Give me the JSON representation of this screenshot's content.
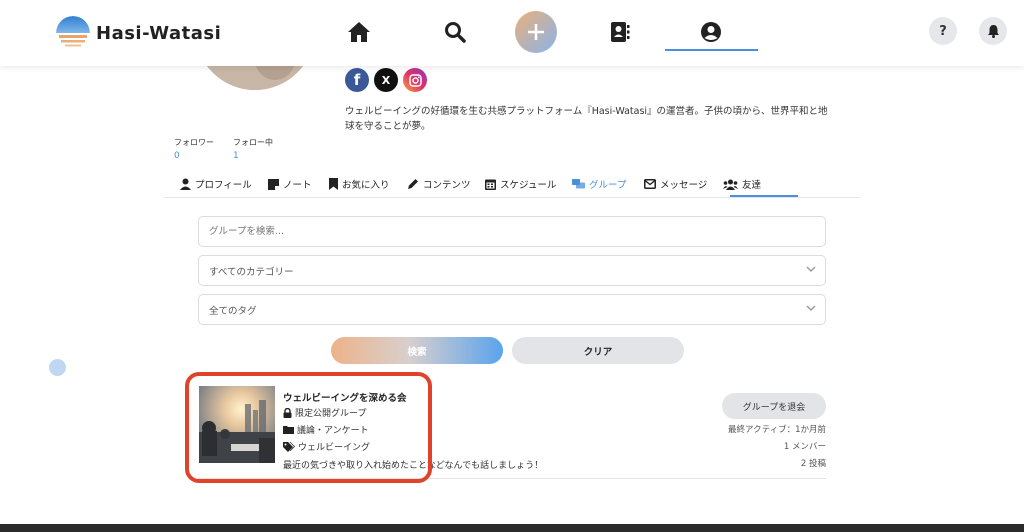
{
  "app": {
    "logo_text": "Hasi-Watasi"
  },
  "header": {
    "nav": [
      "home-icon",
      "search-icon",
      "plus-icon",
      "address-book-icon",
      "user-circle-icon"
    ],
    "help_label": "?",
    "colors": {
      "accent": "#4a90d9"
    }
  },
  "profile": {
    "socials": [
      "facebook-icon",
      "x-icon",
      "instagram-icon"
    ],
    "x_letter": "X",
    "bio": "ウェルビーイングの好循環を生む共感プラットフォーム『Hasi-Watasi』の運営者。子供の頃から、世界平和と地球を守ることが夢。",
    "followers_label": "フォロワー",
    "followers_count": "0",
    "following_label": "フォロー中",
    "following_count": "1"
  },
  "tabs": [
    {
      "label": "プロフィール",
      "icon": "user-icon"
    },
    {
      "label": "ノート",
      "icon": "note-icon"
    },
    {
      "label": "お気に入り",
      "icon": "bookmark-icon"
    },
    {
      "label": "コンテンツ",
      "icon": "pencil-icon"
    },
    {
      "label": "スケジュール",
      "icon": "calendar-icon"
    },
    {
      "label": "グループ",
      "icon": "comments-icon",
      "active": true
    },
    {
      "label": "メッセージ",
      "icon": "envelope-icon"
    },
    {
      "label": "友達",
      "icon": "users-icon"
    }
  ],
  "search": {
    "placeholder": "グループを検索...",
    "category_value": "すべてのカテゴリー",
    "tag_value": "全てのタグ",
    "search_label": "検索",
    "clear_label": "クリア"
  },
  "group": {
    "title": "ウェルビーイングを深める会",
    "privacy": "限定公開グループ",
    "category": "議論・アンケート",
    "tag": "ウェルビーイング",
    "description": "最近の気づきや取り入れ始めたことなどなんでも話しましょう！",
    "leave_label": "グループを退会",
    "last_active": "最終アクティブ：1か月前",
    "members": "1 メンバー",
    "posts": "2 投稿"
  }
}
